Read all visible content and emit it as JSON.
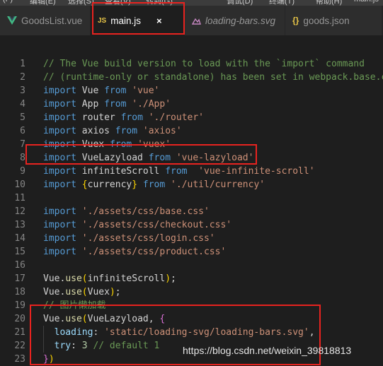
{
  "menu": {
    "items": [
      "(F)",
      "编辑(E)",
      "选择(S)",
      "查看(V)",
      "转到(G)",
      "调试(D)",
      "终端(T)",
      "帮助(H)",
      "main.js"
    ]
  },
  "tabs": [
    {
      "label": "GoodsList.vue",
      "icon": "vue-icon",
      "active": false,
      "italic": false
    },
    {
      "label": "main.js",
      "icon": "js-icon",
      "icon_text": "JS",
      "active": true,
      "italic": false,
      "close": "×"
    },
    {
      "label": "loading-bars.svg",
      "icon": "svg-icon",
      "active": false,
      "italic": true
    },
    {
      "label": "goods.json",
      "icon": "json-icon",
      "icon_text": "{}",
      "active": false,
      "italic": false
    }
  ],
  "lines": [
    {
      "n": "1",
      "tokens": [
        {
          "t": "// The Vue build version to load with the `import` command",
          "c": "cm"
        }
      ]
    },
    {
      "n": "2",
      "tokens": [
        {
          "t": "// (runtime-only or standalone) has been set in webpack.base.co",
          "c": "cm"
        }
      ]
    },
    {
      "n": "3",
      "tokens": [
        {
          "t": "import",
          "c": "kw"
        },
        {
          "t": " Vue ",
          "c": "id"
        },
        {
          "t": "from",
          "c": "kw"
        },
        {
          "t": " ",
          "c": "id"
        },
        {
          "t": "'vue'",
          "c": "str"
        }
      ]
    },
    {
      "n": "4",
      "tokens": [
        {
          "t": "import",
          "c": "kw"
        },
        {
          "t": " App ",
          "c": "id"
        },
        {
          "t": "from",
          "c": "kw"
        },
        {
          "t": " ",
          "c": "id"
        },
        {
          "t": "'./App'",
          "c": "str"
        }
      ]
    },
    {
      "n": "5",
      "tokens": [
        {
          "t": "import",
          "c": "kw"
        },
        {
          "t": " router ",
          "c": "id"
        },
        {
          "t": "from",
          "c": "kw"
        },
        {
          "t": " ",
          "c": "id"
        },
        {
          "t": "'./router'",
          "c": "str"
        }
      ]
    },
    {
      "n": "6",
      "tokens": [
        {
          "t": "import",
          "c": "kw"
        },
        {
          "t": " axios ",
          "c": "id"
        },
        {
          "t": "from",
          "c": "kw"
        },
        {
          "t": " ",
          "c": "id"
        },
        {
          "t": "'axios'",
          "c": "str"
        }
      ]
    },
    {
      "n": "7",
      "tokens": [
        {
          "t": "import",
          "c": "kw"
        },
        {
          "t": " Vuex ",
          "c": "id"
        },
        {
          "t": "from",
          "c": "kw"
        },
        {
          "t": " ",
          "c": "id"
        },
        {
          "t": "'vuex'",
          "c": "str"
        }
      ]
    },
    {
      "n": "8",
      "tokens": [
        {
          "t": "import",
          "c": "kw"
        },
        {
          "t": " VueLazyload ",
          "c": "id"
        },
        {
          "t": "from",
          "c": "kw"
        },
        {
          "t": " ",
          "c": "id"
        },
        {
          "t": "'vue-lazyload'",
          "c": "str"
        }
      ]
    },
    {
      "n": "9",
      "tokens": [
        {
          "t": "import",
          "c": "kw"
        },
        {
          "t": " infiniteScroll ",
          "c": "id"
        },
        {
          "t": "from",
          "c": "kw"
        },
        {
          "t": "  ",
          "c": "id"
        },
        {
          "t": "'vue-infinite-scroll'",
          "c": "str"
        }
      ]
    },
    {
      "n": "10",
      "tokens": [
        {
          "t": "import",
          "c": "kw"
        },
        {
          "t": " ",
          "c": "id"
        },
        {
          "t": "{",
          "c": "br2"
        },
        {
          "t": "currency",
          "c": "id"
        },
        {
          "t": "}",
          "c": "br2"
        },
        {
          "t": " ",
          "c": "id"
        },
        {
          "t": "from",
          "c": "kw"
        },
        {
          "t": " ",
          "c": "id"
        },
        {
          "t": "'./util/currency'",
          "c": "str"
        }
      ]
    },
    {
      "n": "11",
      "tokens": []
    },
    {
      "n": "12",
      "tokens": [
        {
          "t": "import",
          "c": "kw"
        },
        {
          "t": " ",
          "c": "id"
        },
        {
          "t": "'./assets/css/base.css'",
          "c": "str"
        }
      ]
    },
    {
      "n": "13",
      "tokens": [
        {
          "t": "import",
          "c": "kw"
        },
        {
          "t": " ",
          "c": "id"
        },
        {
          "t": "'./assets/css/checkout.css'",
          "c": "str"
        }
      ]
    },
    {
      "n": "14",
      "tokens": [
        {
          "t": "import",
          "c": "kw"
        },
        {
          "t": " ",
          "c": "id"
        },
        {
          "t": "'./assets/css/login.css'",
          "c": "str"
        }
      ]
    },
    {
      "n": "15",
      "tokens": [
        {
          "t": "import",
          "c": "kw"
        },
        {
          "t": " ",
          "c": "id"
        },
        {
          "t": "'./assets/css/product.css'",
          "c": "str"
        }
      ]
    },
    {
      "n": "16",
      "tokens": []
    },
    {
      "n": "17",
      "tokens": [
        {
          "t": "Vue",
          "c": "id"
        },
        {
          "t": ".",
          "c": "pun"
        },
        {
          "t": "use",
          "c": "fn"
        },
        {
          "t": "(",
          "c": "br2"
        },
        {
          "t": "infiniteScroll",
          "c": "id"
        },
        {
          "t": ")",
          "c": "br2"
        },
        {
          "t": ";",
          "c": "pun"
        }
      ]
    },
    {
      "n": "18",
      "tokens": [
        {
          "t": "Vue",
          "c": "id"
        },
        {
          "t": ".",
          "c": "pun"
        },
        {
          "t": "use",
          "c": "fn"
        },
        {
          "t": "(",
          "c": "br2"
        },
        {
          "t": "Vuex",
          "c": "id"
        },
        {
          "t": ")",
          "c": "br2"
        },
        {
          "t": ";",
          "c": "pun"
        }
      ]
    },
    {
      "n": "19",
      "tokens": [
        {
          "t": "// 图片懒加载",
          "c": "cm"
        }
      ]
    },
    {
      "n": "20",
      "tokens": [
        {
          "t": "Vue",
          "c": "id"
        },
        {
          "t": ".",
          "c": "pun"
        },
        {
          "t": "use",
          "c": "fn"
        },
        {
          "t": "(",
          "c": "br2"
        },
        {
          "t": "VueLazyload",
          "c": "id"
        },
        {
          "t": ", ",
          "c": "pun"
        },
        {
          "t": "{",
          "c": "br"
        }
      ]
    },
    {
      "n": "21",
      "tokens": [
        {
          "t": "  ",
          "c": "id"
        },
        {
          "t": "loading",
          "c": "var"
        },
        {
          "t": ": ",
          "c": "pun"
        },
        {
          "t": "'static/loading-svg/loading-bars.svg'",
          "c": "str"
        },
        {
          "t": ",",
          "c": "pun"
        }
      ]
    },
    {
      "n": "22",
      "tokens": [
        {
          "t": "  ",
          "c": "id"
        },
        {
          "t": "try",
          "c": "var"
        },
        {
          "t": ": ",
          "c": "pun"
        },
        {
          "t": "3",
          "c": "num"
        },
        {
          "t": " ",
          "c": "id"
        },
        {
          "t": "// default 1",
          "c": "cm"
        }
      ]
    },
    {
      "n": "23",
      "tokens": [
        {
          "t": "}",
          "c": "br"
        },
        {
          "t": ")",
          "c": "br2"
        }
      ]
    }
  ],
  "watermark": "https://blog.csdn.net/weixin_39818813"
}
